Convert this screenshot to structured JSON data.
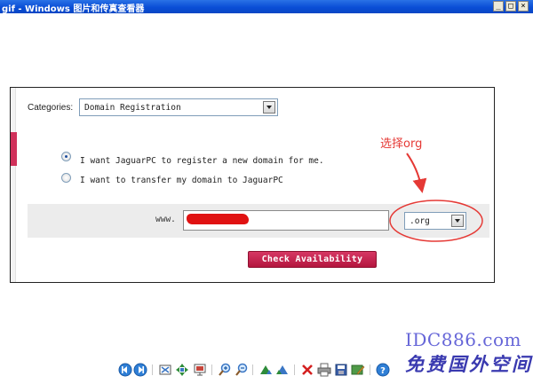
{
  "window": {
    "title": "gif - Windows 图片和传真查看器",
    "minimize_label": "_",
    "maximize_label": "□",
    "close_label": "×"
  },
  "form": {
    "categories_label": "Categories:",
    "category_value": "Domain Registration",
    "radio_options": [
      {
        "label": "I want JaguarPC to register a new domain for me.",
        "checked": true
      },
      {
        "label": "I want to transfer my domain to JaguarPC",
        "checked": false
      }
    ],
    "www_label": "www.",
    "domain_value": "",
    "tld_value": ".org",
    "check_button_label": "Check Availability"
  },
  "annotation": {
    "text": "选择org",
    "color": "#e53935"
  },
  "watermark": {
    "domain": "IDC886.com",
    "chinese": "免费国外空间"
  },
  "toolbar": {
    "icons": [
      "prev-image-icon",
      "next-image-icon",
      "best-fit-icon",
      "actual-size-icon",
      "slideshow-icon",
      "zoom-in-icon",
      "zoom-out-icon",
      "rotate-clockwise-icon",
      "rotate-counterclockwise-icon",
      "delete-icon",
      "print-icon",
      "save-icon",
      "edit-icon",
      "help-icon"
    ]
  },
  "colors": {
    "titlebar": "#0a4ed6",
    "accent": "#c4234f",
    "annotation": "#e53935"
  }
}
